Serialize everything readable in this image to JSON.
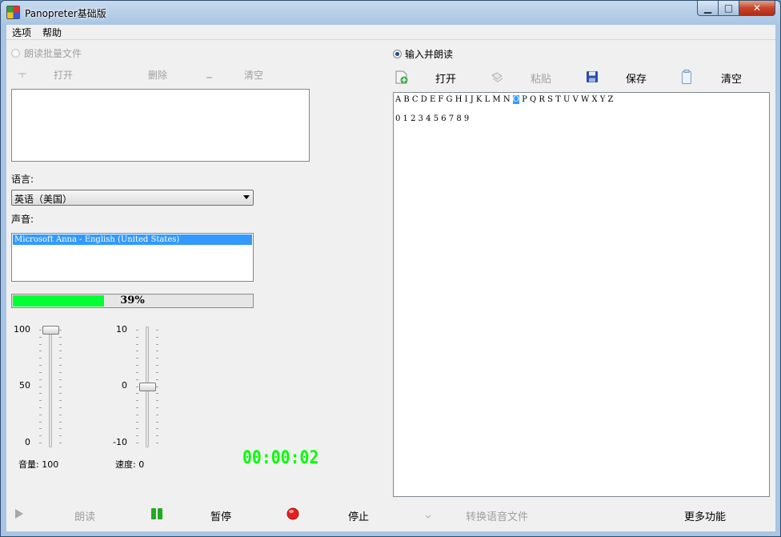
{
  "window": {
    "title": "Panopreter基础版"
  },
  "menu": {
    "options": "选项",
    "help": "帮助"
  },
  "left": {
    "batch_radio_label": "朗读批量文件",
    "open_label": "打开",
    "delete_label": "删除",
    "clear_label": "清空",
    "language_label": "语言:",
    "language_value": "英语（美国）",
    "voice_label": "声音:",
    "voice_selected": "Microsoft Anna - English (United States)",
    "progress": {
      "value": 0.39,
      "text": "39%"
    },
    "volume": {
      "label": "音量:",
      "value": "100",
      "ticks": [
        "100",
        "50",
        "0"
      ],
      "level": 1.0
    },
    "speed": {
      "label": "速度:",
      "value": "0",
      "ticks": [
        "10",
        "0",
        "-10"
      ],
      "level": 0.5
    },
    "timer": "00:00:02"
  },
  "right": {
    "input_radio_label": "输入并朗读",
    "open_label": "打开",
    "paste_label": "粘贴",
    "save_label": "保存",
    "clear_label": "清空",
    "text_line1_before": "A B C D E F G H I J K L M N ",
    "text_line1_sel": "O",
    "text_line1_after": " P Q R S T U V W X Y Z",
    "text_line2": "0 1 2 3 4 5 6 7 8 9"
  },
  "bottom": {
    "read_label": "朗读",
    "pause_label": "暂停",
    "stop_label": "停止",
    "convert_label": "转换语音文件",
    "more_label": "更多功能"
  },
  "colors": {
    "progress": "#00ff33",
    "timer": "#00ff00",
    "selection": "#3399ff",
    "stop": "#e02020",
    "pause": "#22aa22"
  }
}
